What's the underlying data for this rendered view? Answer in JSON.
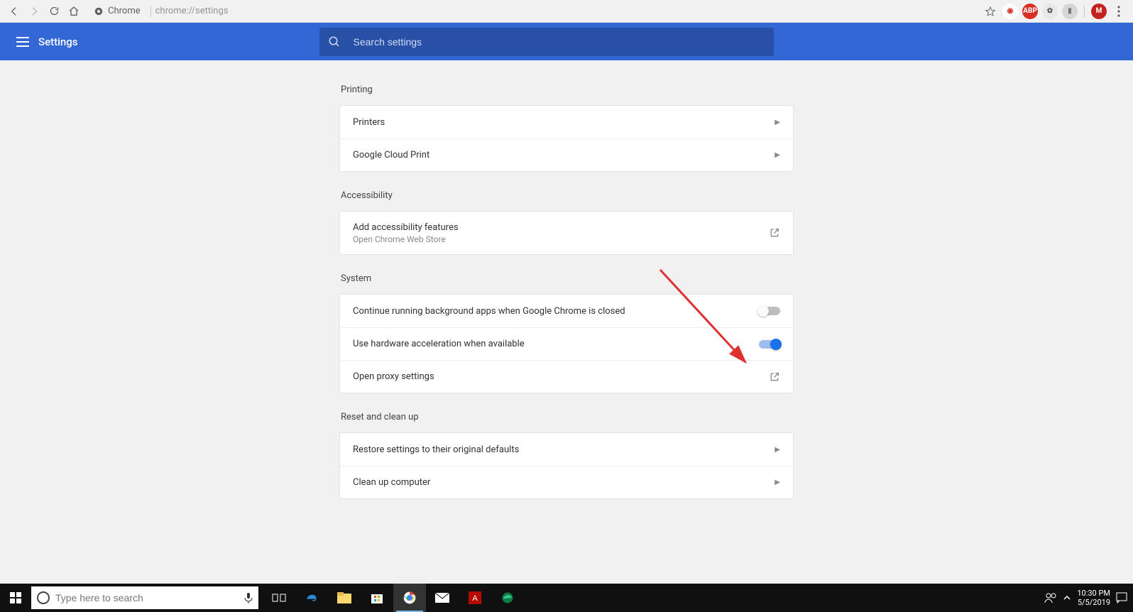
{
  "browser": {
    "chip_label": "Chrome",
    "url": "chrome://settings",
    "extensions": [
      {
        "name": "ublock-ext-icon",
        "bg": "#ffffff",
        "fg": "#d93025",
        "text": "◉"
      },
      {
        "name": "abp-ext-icon",
        "bg": "#d93025",
        "fg": "#ffffff",
        "text": "ABP"
      },
      {
        "name": "gear-ext-icon",
        "bg": "#e8e8e8",
        "fg": "#555",
        "text": "✿"
      },
      {
        "name": "ext-icon-4",
        "bg": "#d6d6d6",
        "fg": "#777",
        "text": "▮"
      }
    ],
    "profile": {
      "bg": "#c5221f",
      "fg": "#ffffff",
      "text": "M"
    }
  },
  "header": {
    "title": "Settings",
    "search_placeholder": "Search settings"
  },
  "sections": {
    "printing": {
      "title": "Printing",
      "items": [
        {
          "label": "Printers"
        },
        {
          "label": "Google Cloud Print"
        }
      ]
    },
    "accessibility": {
      "title": "Accessibility",
      "item": {
        "label": "Add accessibility features",
        "sub": "Open Chrome Web Store"
      }
    },
    "system": {
      "title": "System",
      "items": [
        {
          "label": "Continue running background apps when Google Chrome is closed",
          "toggle": false
        },
        {
          "label": "Use hardware acceleration when available",
          "toggle": true
        },
        {
          "label": "Open proxy settings"
        }
      ]
    },
    "reset": {
      "title": "Reset and clean up",
      "items": [
        {
          "label": "Restore settings to their original defaults"
        },
        {
          "label": "Clean up computer"
        }
      ]
    }
  },
  "taskbar": {
    "search_placeholder": "Type here to search",
    "time": "10:30 PM",
    "date": "5/5/2019"
  }
}
